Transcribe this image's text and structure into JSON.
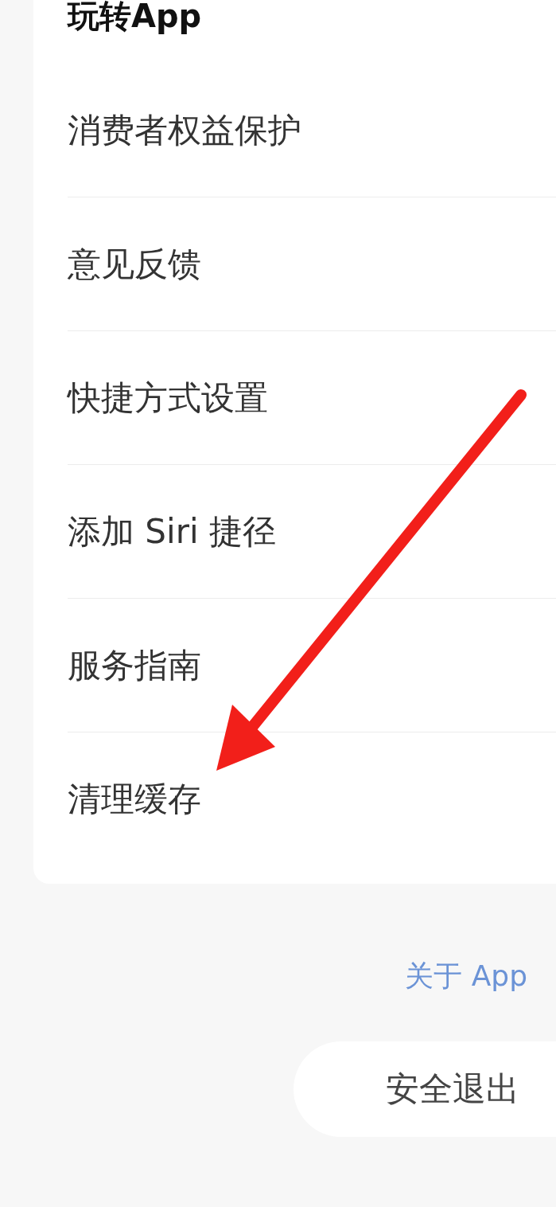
{
  "section": {
    "title": "玩转App"
  },
  "menu_items": [
    {
      "label": "消费者权益保护"
    },
    {
      "label": "意见反馈"
    },
    {
      "label": "快捷方式设置"
    },
    {
      "label": "添加 Siri 捷径"
    },
    {
      "label": "服务指南"
    },
    {
      "label": "清理缓存"
    }
  ],
  "about_link": "关于 App",
  "logout_button": "安全退出"
}
